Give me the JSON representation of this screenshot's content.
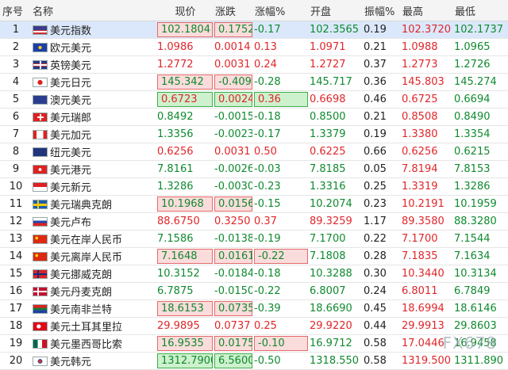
{
  "headers": [
    "序号",
    "名称",
    "现价",
    "涨跌",
    "涨幅%",
    "开盘",
    "振幅%",
    "最高",
    "最低"
  ],
  "selected_row": 0,
  "rows": [
    {
      "i": "1",
      "name": "美元指数",
      "flag": "us",
      "price": "102.1804",
      "chg": "0.1752",
      "pct": "-0.17",
      "open": "102.3565",
      "amp": "0.19",
      "high": "102.3720",
      "low": "102.1737",
      "dir": "down",
      "box_price": "red",
      "box_chg": "red",
      "box_pct": ""
    },
    {
      "i": "2",
      "name": "欧元美元",
      "flag": "eu",
      "price": "1.0986",
      "chg": "0.0014",
      "pct": "0.13",
      "open": "1.0971",
      "amp": "0.21",
      "high": "1.0988",
      "low": "1.0965",
      "dir": "up",
      "box_price": "",
      "box_chg": "",
      "box_pct": ""
    },
    {
      "i": "3",
      "name": "英镑美元",
      "flag": "gb",
      "price": "1.2772",
      "chg": "0.0031",
      "pct": "0.24",
      "open": "1.2727",
      "amp": "0.37",
      "high": "1.2773",
      "low": "1.2726",
      "dir": "up",
      "box_price": "",
      "box_chg": "",
      "box_pct": ""
    },
    {
      "i": "4",
      "name": "美元日元",
      "flag": "jp",
      "price": "145.342",
      "chg": "-0.409",
      "pct": "-0.28",
      "open": "145.717",
      "amp": "0.36",
      "high": "145.803",
      "low": "145.274",
      "dir": "down",
      "box_price": "red",
      "box_chg": "red",
      "box_pct": ""
    },
    {
      "i": "5",
      "name": "澳元美元",
      "flag": "au",
      "price": "0.6723",
      "chg": "0.0024",
      "pct": "0.36",
      "open": "0.6698",
      "amp": "0.46",
      "high": "0.6725",
      "low": "0.6694",
      "dir": "up",
      "box_price": "green",
      "box_chg": "green",
      "box_pct": "green"
    },
    {
      "i": "6",
      "name": "美元瑞郎",
      "flag": "ch",
      "price": "0.8492",
      "chg": "-0.0015",
      "pct": "-0.18",
      "open": "0.8500",
      "amp": "0.21",
      "high": "0.8508",
      "low": "0.8490",
      "dir": "down",
      "box_price": "",
      "box_chg": "",
      "box_pct": ""
    },
    {
      "i": "7",
      "name": "美元加元",
      "flag": "ca",
      "price": "1.3356",
      "chg": "-0.0023",
      "pct": "-0.17",
      "open": "1.3379",
      "amp": "0.19",
      "high": "1.3380",
      "low": "1.3354",
      "dir": "down",
      "box_price": "",
      "box_chg": "",
      "box_pct": ""
    },
    {
      "i": "8",
      "name": "纽元美元",
      "flag": "nz",
      "price": "0.6256",
      "chg": "0.0031",
      "pct": "0.50",
      "open": "0.6225",
      "amp": "0.66",
      "high": "0.6256",
      "low": "0.6215",
      "dir": "up",
      "box_price": "",
      "box_chg": "",
      "box_pct": ""
    },
    {
      "i": "9",
      "name": "美元港元",
      "flag": "hk",
      "price": "7.8161",
      "chg": "-0.0026",
      "pct": "-0.03",
      "open": "7.8185",
      "amp": "0.05",
      "high": "7.8194",
      "low": "7.8153",
      "dir": "down",
      "box_price": "",
      "box_chg": "",
      "box_pct": ""
    },
    {
      "i": "10",
      "name": "美元新元",
      "flag": "sg",
      "price": "1.3286",
      "chg": "-0.0030",
      "pct": "-0.23",
      "open": "1.3316",
      "amp": "0.25",
      "high": "1.3319",
      "low": "1.3286",
      "dir": "down",
      "box_price": "",
      "box_chg": "",
      "box_pct": ""
    },
    {
      "i": "11",
      "name": "美元瑞典克朗",
      "flag": "se",
      "price": "10.1968",
      "chg": "0.0156",
      "pct": "-0.15",
      "open": "10.2074",
      "amp": "0.23",
      "high": "10.2191",
      "low": "10.1959",
      "dir": "down",
      "box_price": "red",
      "box_chg": "red",
      "box_pct": ""
    },
    {
      "i": "12",
      "name": "美元卢布",
      "flag": "ru",
      "price": "88.6750",
      "chg": "0.3250",
      "pct": "0.37",
      "open": "89.3259",
      "amp": "1.17",
      "high": "89.3580",
      "low": "88.3280",
      "dir": "up",
      "box_price": "",
      "box_chg": "",
      "box_pct": ""
    },
    {
      "i": "13",
      "name": "美元在岸人民币",
      "flag": "cn",
      "price": "7.1586",
      "chg": "-0.0138",
      "pct": "-0.19",
      "open": "7.1700",
      "amp": "0.22",
      "high": "7.1700",
      "low": "7.1544",
      "dir": "down",
      "box_price": "",
      "box_chg": "",
      "box_pct": ""
    },
    {
      "i": "14",
      "name": "美元离岸人民币",
      "flag": "cn",
      "price": "7.1648",
      "chg": "0.0161",
      "pct": "-0.22",
      "open": "7.1808",
      "amp": "0.28",
      "high": "7.1835",
      "low": "7.1634",
      "dir": "down",
      "box_price": "red",
      "box_chg": "red",
      "box_pct": "red"
    },
    {
      "i": "15",
      "name": "美元挪威克朗",
      "flag": "no",
      "price": "10.3152",
      "chg": "-0.0184",
      "pct": "-0.18",
      "open": "10.3288",
      "amp": "0.30",
      "high": "10.3440",
      "low": "10.3134",
      "dir": "down",
      "box_price": "",
      "box_chg": "",
      "box_pct": ""
    },
    {
      "i": "16",
      "name": "美元丹麦克朗",
      "flag": "dk",
      "price": "6.7875",
      "chg": "-0.0150",
      "pct": "-0.22",
      "open": "6.8007",
      "amp": "0.24",
      "high": "6.8011",
      "low": "6.7849",
      "dir": "down",
      "box_price": "",
      "box_chg": "",
      "box_pct": ""
    },
    {
      "i": "17",
      "name": "美元南非兰特",
      "flag": "za",
      "price": "18.6153",
      "chg": "0.0735",
      "pct": "-0.39",
      "open": "18.6690",
      "amp": "0.45",
      "high": "18.6994",
      "low": "18.6146",
      "dir": "down",
      "box_price": "red",
      "box_chg": "red",
      "box_pct": ""
    },
    {
      "i": "18",
      "name": "美元土耳其里拉",
      "flag": "tr",
      "price": "29.9895",
      "chg": "0.0737",
      "pct": "0.25",
      "open": "29.9220",
      "amp": "0.44",
      "high": "29.9913",
      "low": "29.8603",
      "dir": "up",
      "box_price": "",
      "box_chg": "",
      "box_pct": ""
    },
    {
      "i": "19",
      "name": "美元墨西哥比索",
      "flag": "mx",
      "price": "16.9535",
      "chg": "0.0175",
      "pct": "-0.10",
      "open": "16.9712",
      "amp": "0.58",
      "high": "17.0446",
      "low": "16.9458",
      "dir": "down",
      "box_price": "red",
      "box_chg": "red",
      "box_pct": "red"
    },
    {
      "i": "20",
      "name": "美元韩元",
      "flag": "kr",
      "price": "1312.7900",
      "chg": "6.5600",
      "pct": "-0.50",
      "open": "1318.550",
      "amp": "0.58",
      "high": "1319.500",
      "low": "1311.890",
      "dir": "down",
      "box_price": "green",
      "box_chg": "green",
      "box_pct": ""
    }
  ],
  "watermark": "FX678",
  "colors": {
    "up": "#e0262a",
    "down": "#0f8a2f",
    "selected": "#dbe8fb"
  }
}
